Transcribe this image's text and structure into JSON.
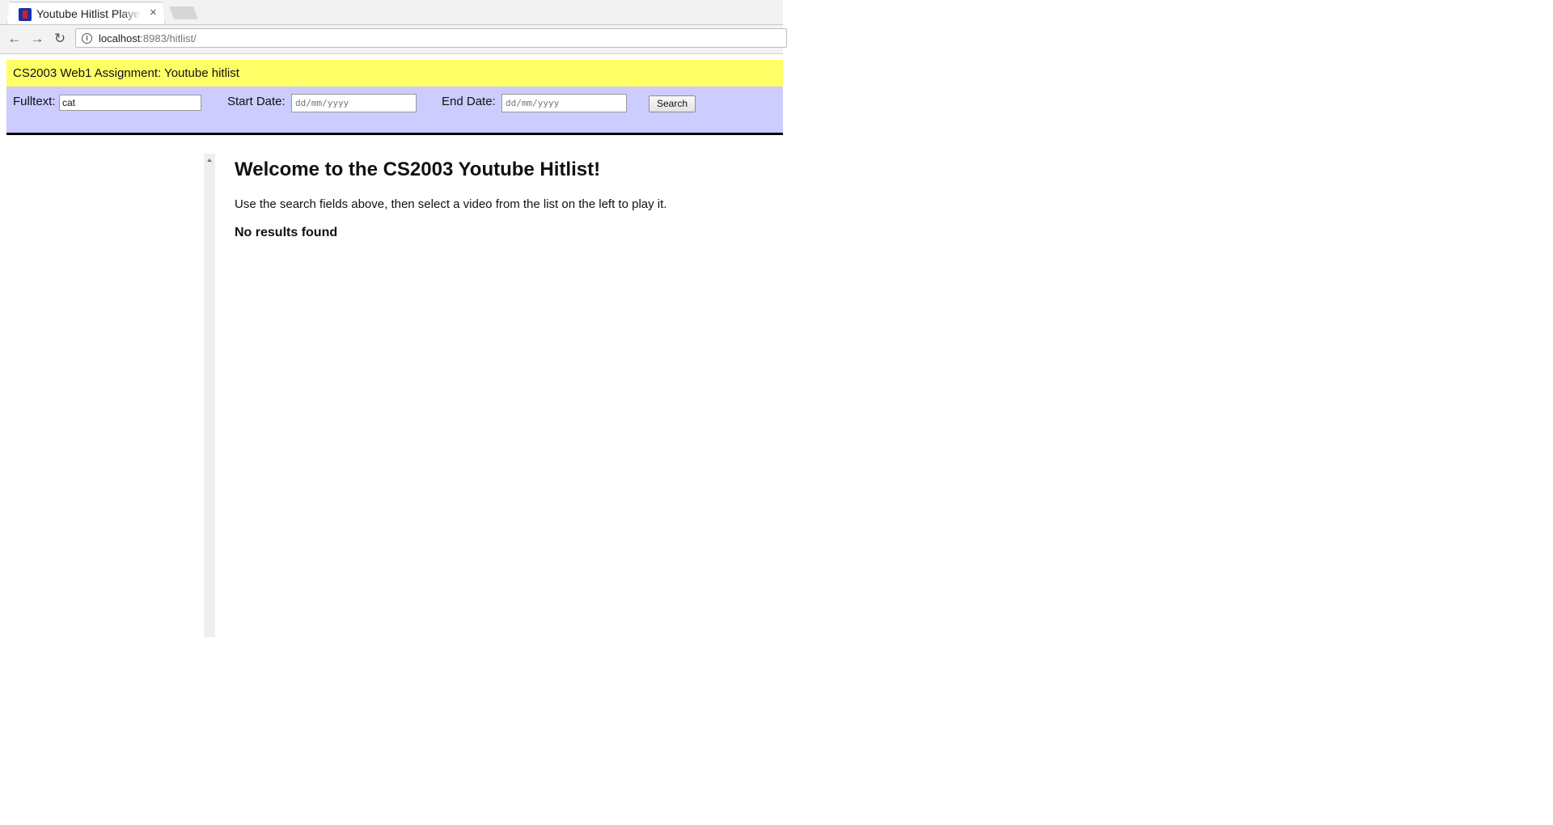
{
  "browser": {
    "tab_title": "Youtube Hitlist Player",
    "tab_close": "×",
    "url_host": "localhost",
    "url_rest": ":8983/hitlist/",
    "nav": {
      "back": "←",
      "forward": "→",
      "reload": "↻"
    }
  },
  "page": {
    "banner": "CS2003 Web1 Assignment: Youtube hitlist",
    "search": {
      "fulltext_label": "Fulltext:",
      "fulltext_value": "cat",
      "start_label": "Start Date:",
      "start_placeholder": "dd/mm/yyyy",
      "end_label": "End Date:",
      "end_placeholder": "dd/mm/yyyy",
      "button_label": "Search"
    },
    "title": "Welcome to the CS2003 Youtube Hitlist!",
    "intro": "Use the search fields above, then select a video from the list on the left to play it.",
    "results": "No results found"
  },
  "colors": {
    "banner": "#ffff66",
    "searchbar": "#ccccff"
  }
}
